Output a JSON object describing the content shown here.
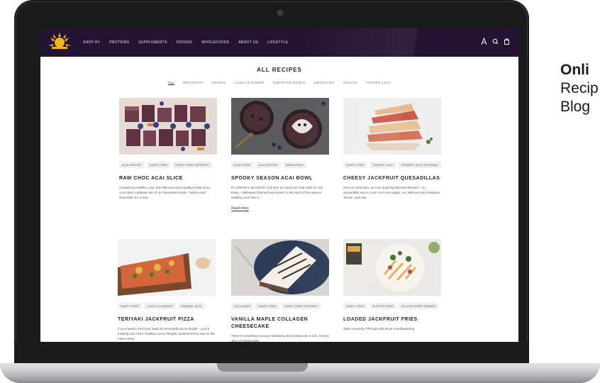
{
  "side_text": {
    "title": "Onli",
    "line2": "Recip",
    "line3": "Blog"
  },
  "nav": {
    "links": [
      "SHOP BY",
      "PROTEINS",
      "SUPPLEMENTS",
      "FROZEN",
      "WHOLEFOODS",
      "ABOUT US",
      "LIFESTYLE"
    ],
    "icons": [
      "account-icon",
      "search-icon",
      "cart-icon"
    ]
  },
  "page": {
    "title": "ALL RECIPES",
    "filters": [
      "ALL",
      "BREAKFAST",
      "DRINKS",
      "LUNCH & DINNER",
      "SMOOTHIE BOWLS",
      "SMOOTHIES",
      "SNACKS",
      "TENDER JACK"
    ]
  },
  "recipes": [
    {
      "tags": [
        "ACAI RECIPE",
        "DAIRY FREE",
        "DAIRY FREE DESSERT"
      ],
      "title": "RAW CHOC ACAI SLICE",
      "desc": "Created by Healthy Luxe, this delicious (and healthy!) Raw Choc Acai Slice combines two of our favourites foods – berries and chocolate! It's a mat...",
      "read_more": ""
    },
    {
      "tags": [
        "ACAI PURE",
        "ACAI RECIPE",
        "BREAKFAST"
      ],
      "title": "SPOOKY SEASON ACAI BOWL",
      "desc": "It's SPOOKY SEASON!! And here at Amazonia, that calls for one thing – Halloween themed acai bowls! In the spirit of the season, Healthy Luxe has cr...",
      "read_more": "Read more"
    },
    {
      "tags": [
        "DAIRY FREE",
        "TENDER JACK",
        "TENDER JACK ORIGINAL"
      ],
      "title": "CHEESY JACKFRUIT QUESADILLAS",
      "desc": "Here at Amazonia, we love anything Mexican themed – so quesadillas was a must! And once again, our delicious and nutritious Tender Jack has",
      "read_more": ""
    },
    {
      "tags": [
        "DAIRY FREE",
        "LUNCH & DINNER",
        "TENDER JACK"
      ],
      "title": "TERIYAKI JACKFRUIT PIZZA",
      "desc": "If you haven't tried your hand at homemade pizza dough – you're missing out! And if Healthy Luxe's Teriyaki Jackfruit Pizza was on the menu every",
      "read_more": ""
    },
    {
      "tags": [
        "COLLAGEN",
        "DAIRY FREE",
        "DAIRY FREE DESSERT"
      ],
      "title": "VANILLA MAPLE COLLAGEN CHEESECAKE",
      "desc": "There's something soooooo satisfying about biting into a soft, creamy slice of cheesecake.",
      "read_more": ""
    },
    {
      "tags": [
        "DAIRY FREE",
        "GLUTEN FREE",
        "GLUTEN FREE DINNER"
      ],
      "title": "LOADED JACKFRUIT FRIES",
      "desc": "Make everyday FRYday with these mouthwatering",
      "read_more": ""
    }
  ]
}
